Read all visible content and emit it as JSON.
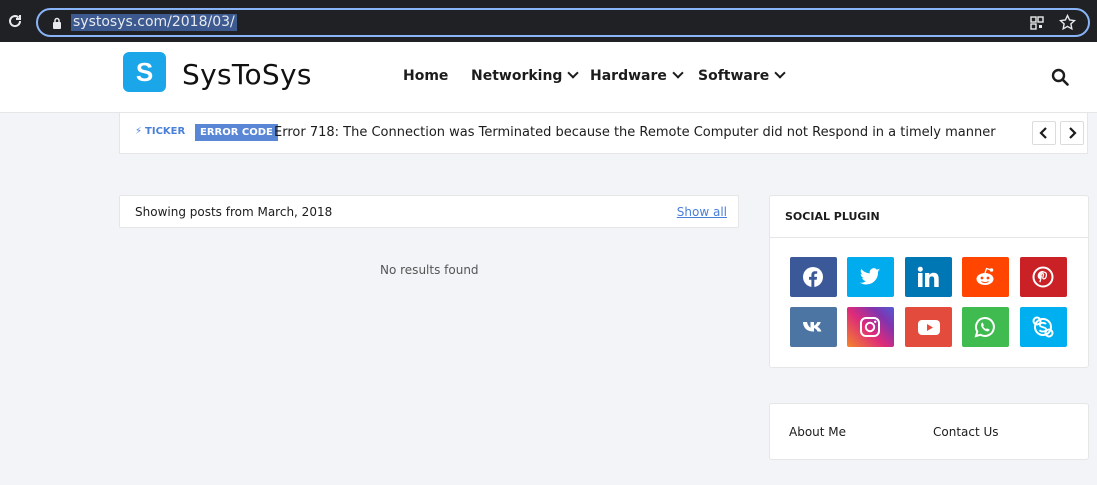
{
  "browser": {
    "url": "systosys.com/2018/03/"
  },
  "site": {
    "logo_letter": "S",
    "name": "SysToSys"
  },
  "nav": {
    "items": [
      {
        "label": "Home"
      },
      {
        "label": "Networking"
      },
      {
        "label": "Hardware"
      },
      {
        "label": "Software"
      }
    ]
  },
  "ticker": {
    "label": "TICKER",
    "tag": "ERROR CODE",
    "text": "Error 718: The Connection was Terminated because the Remote Computer did not Respond in a timely manner"
  },
  "posts": {
    "heading": "Showing posts from March, 2018",
    "show_all": "Show all",
    "empty_message": "No results found"
  },
  "social": {
    "title": "SOCIAL PLUGIN",
    "icons": [
      {
        "name": "facebook-icon",
        "color": "#3b5999"
      },
      {
        "name": "twitter-icon",
        "color": "#00acee"
      },
      {
        "name": "linkedin-icon",
        "color": "#0077b5"
      },
      {
        "name": "reddit-icon",
        "color": "#ff4500"
      },
      {
        "name": "pinterest-icon",
        "color": "#ca2127"
      },
      {
        "name": "vk-icon",
        "color": "#4c75a3"
      },
      {
        "name": "instagram-icon",
        "color": "#c13584"
      },
      {
        "name": "youtube-icon",
        "color": "#e34b3d"
      },
      {
        "name": "whatsapp-icon",
        "color": "#3fbb50"
      },
      {
        "name": "skype-icon",
        "color": "#00aff0"
      }
    ]
  },
  "pages": {
    "links": [
      {
        "label": "About Me"
      },
      {
        "label": "Contact Us"
      }
    ]
  }
}
